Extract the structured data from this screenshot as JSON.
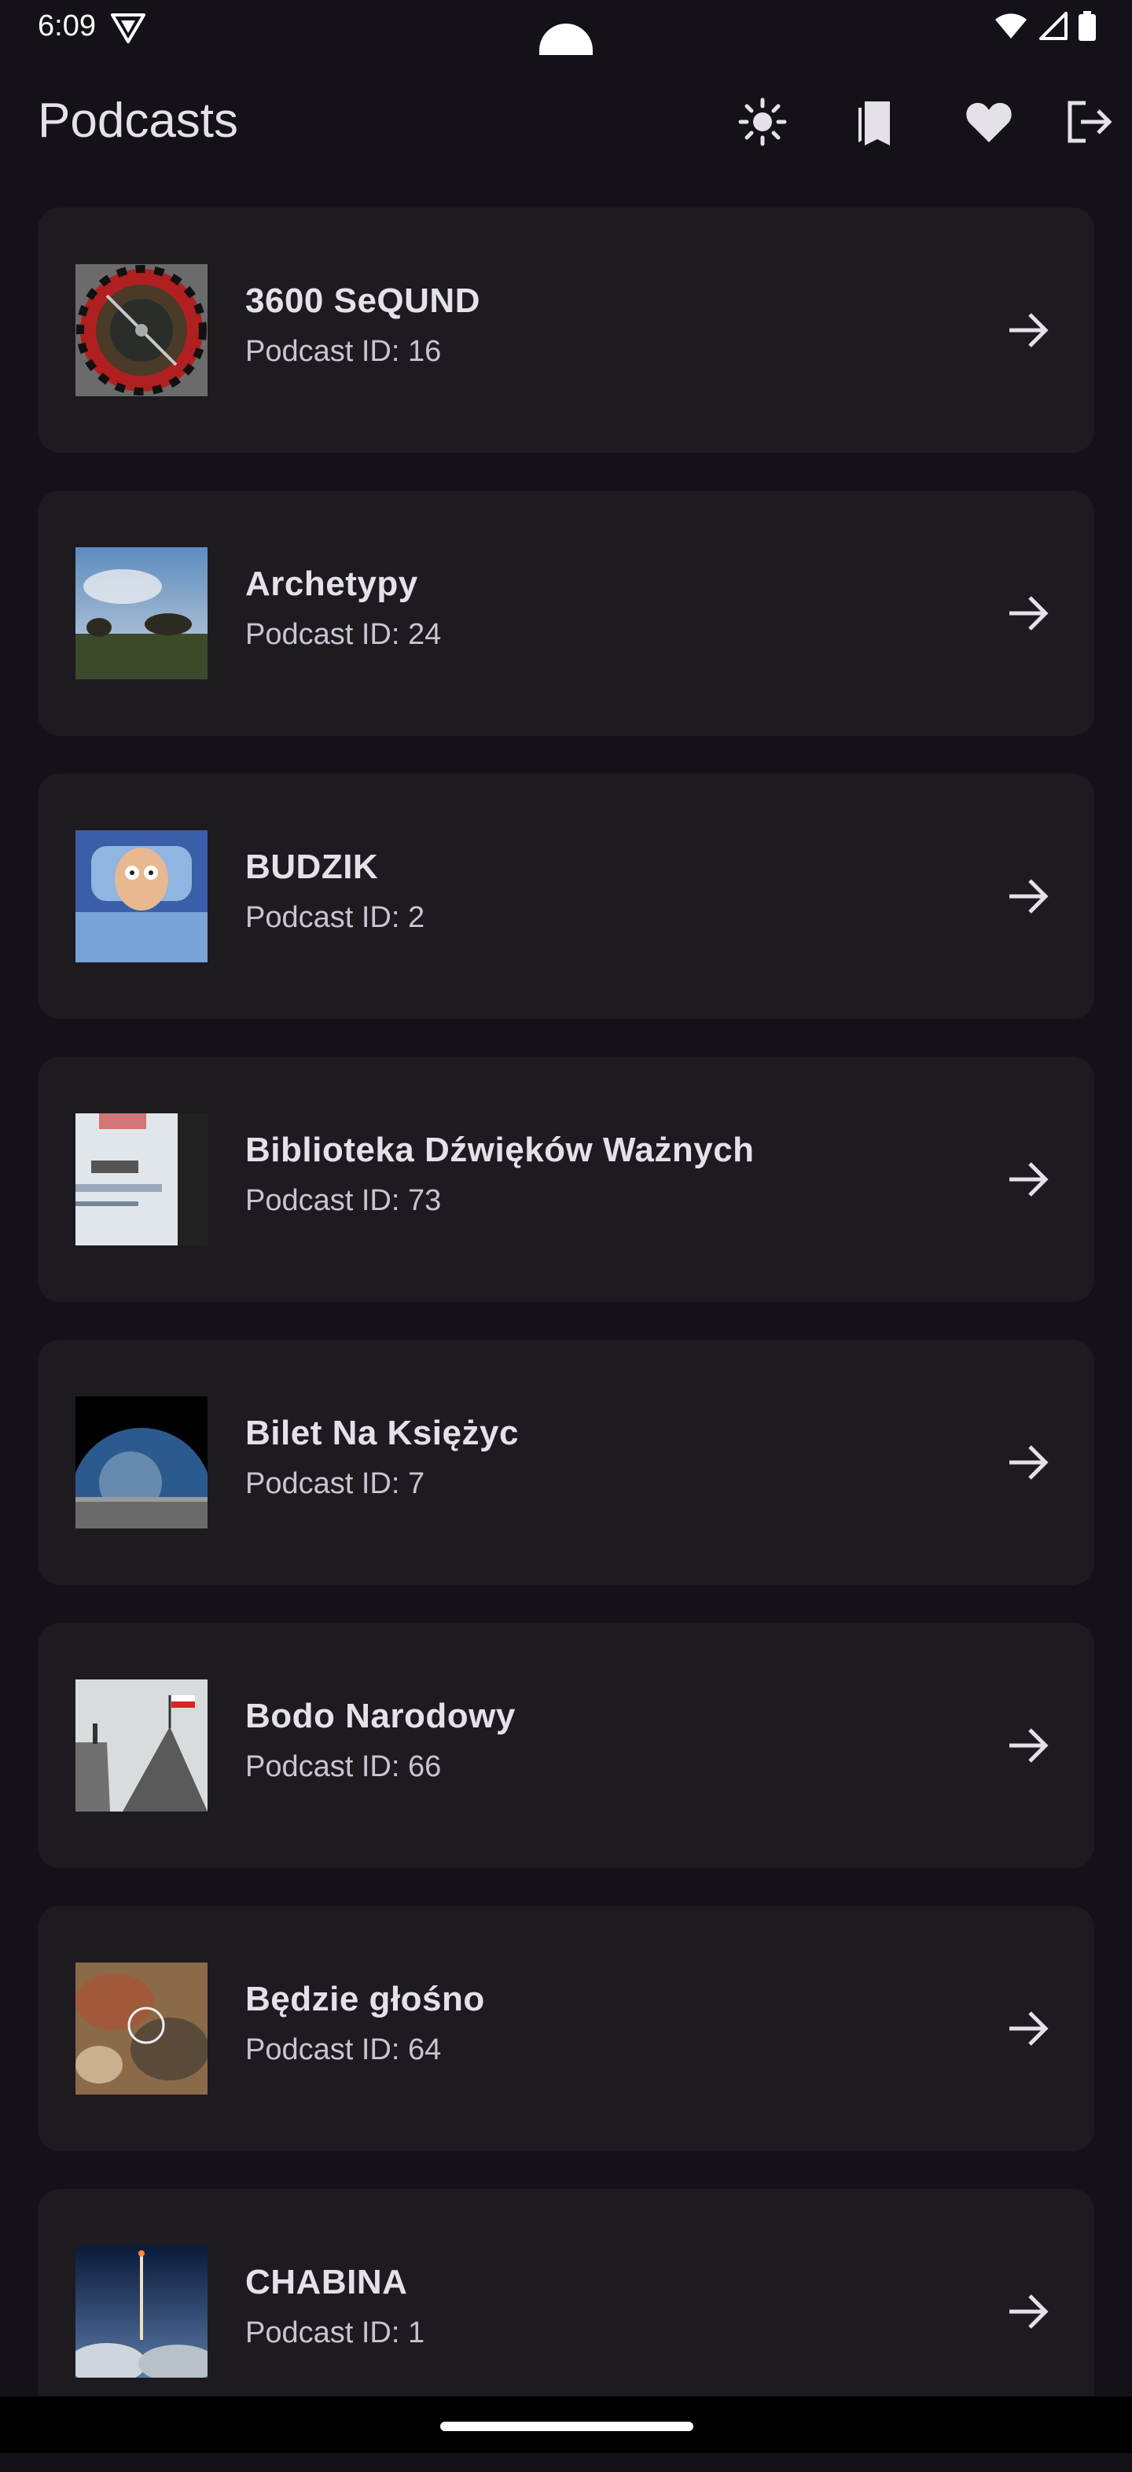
{
  "status_bar": {
    "time": "6:09"
  },
  "app_bar": {
    "title": "Podcasts"
  },
  "actions": {
    "theme_icon": "sun-icon",
    "bookmarks_icon": "bookmark-icon",
    "favorites_icon": "heart-icon",
    "logout_icon": "logout-icon"
  },
  "podcasts": [
    {
      "title": "3600 SeQUND",
      "subtitle": "Podcast ID: 16"
    },
    {
      "title": "Archetypy",
      "subtitle": "Podcast ID: 24"
    },
    {
      "title": "BUDZIK",
      "subtitle": "Podcast ID: 2"
    },
    {
      "title": "Biblioteka Dźwięków Ważnych",
      "subtitle": "Podcast ID: 73"
    },
    {
      "title": "Bilet Na Księżyc",
      "subtitle": "Podcast ID: 7"
    },
    {
      "title": "Bodo Narodowy",
      "subtitle": "Podcast ID: 66"
    },
    {
      "title": "Będzie głośno",
      "subtitle": "Podcast ID: 64"
    },
    {
      "title": "CHABINA",
      "subtitle": "Podcast ID: 1"
    }
  ],
  "colors": {
    "background": "#141218",
    "card": "#1D1B20",
    "text_primary": "#E6E0E9",
    "text_secondary": "#CAC4D0"
  }
}
